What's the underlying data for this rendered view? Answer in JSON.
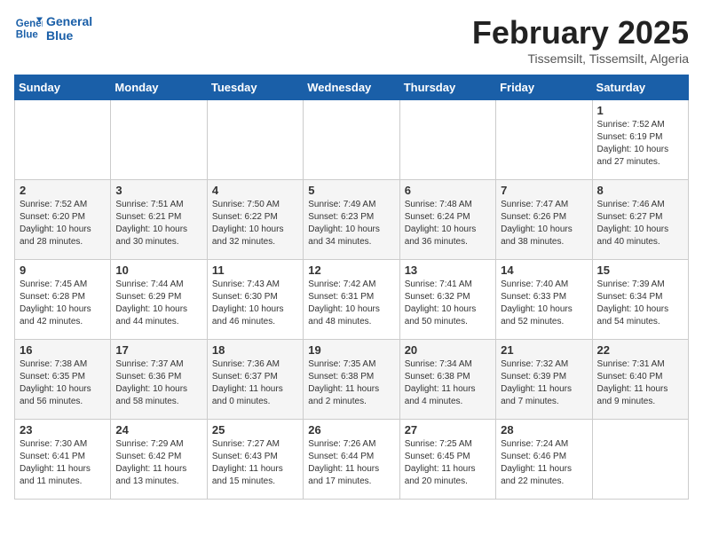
{
  "logo": {
    "line1": "General",
    "line2": "Blue"
  },
  "title": "February 2025",
  "subtitle": "Tissemsilt, Tissemsilt, Algeria",
  "weekdays": [
    "Sunday",
    "Monday",
    "Tuesday",
    "Wednesday",
    "Thursday",
    "Friday",
    "Saturday"
  ],
  "weeks": [
    [
      {
        "day": "",
        "info": ""
      },
      {
        "day": "",
        "info": ""
      },
      {
        "day": "",
        "info": ""
      },
      {
        "day": "",
        "info": ""
      },
      {
        "day": "",
        "info": ""
      },
      {
        "day": "",
        "info": ""
      },
      {
        "day": "1",
        "info": "Sunrise: 7:52 AM\nSunset: 6:19 PM\nDaylight: 10 hours\nand 27 minutes."
      }
    ],
    [
      {
        "day": "2",
        "info": "Sunrise: 7:52 AM\nSunset: 6:20 PM\nDaylight: 10 hours\nand 28 minutes."
      },
      {
        "day": "3",
        "info": "Sunrise: 7:51 AM\nSunset: 6:21 PM\nDaylight: 10 hours\nand 30 minutes."
      },
      {
        "day": "4",
        "info": "Sunrise: 7:50 AM\nSunset: 6:22 PM\nDaylight: 10 hours\nand 32 minutes."
      },
      {
        "day": "5",
        "info": "Sunrise: 7:49 AM\nSunset: 6:23 PM\nDaylight: 10 hours\nand 34 minutes."
      },
      {
        "day": "6",
        "info": "Sunrise: 7:48 AM\nSunset: 6:24 PM\nDaylight: 10 hours\nand 36 minutes."
      },
      {
        "day": "7",
        "info": "Sunrise: 7:47 AM\nSunset: 6:26 PM\nDaylight: 10 hours\nand 38 minutes."
      },
      {
        "day": "8",
        "info": "Sunrise: 7:46 AM\nSunset: 6:27 PM\nDaylight: 10 hours\nand 40 minutes."
      }
    ],
    [
      {
        "day": "9",
        "info": "Sunrise: 7:45 AM\nSunset: 6:28 PM\nDaylight: 10 hours\nand 42 minutes."
      },
      {
        "day": "10",
        "info": "Sunrise: 7:44 AM\nSunset: 6:29 PM\nDaylight: 10 hours\nand 44 minutes."
      },
      {
        "day": "11",
        "info": "Sunrise: 7:43 AM\nSunset: 6:30 PM\nDaylight: 10 hours\nand 46 minutes."
      },
      {
        "day": "12",
        "info": "Sunrise: 7:42 AM\nSunset: 6:31 PM\nDaylight: 10 hours\nand 48 minutes."
      },
      {
        "day": "13",
        "info": "Sunrise: 7:41 AM\nSunset: 6:32 PM\nDaylight: 10 hours\nand 50 minutes."
      },
      {
        "day": "14",
        "info": "Sunrise: 7:40 AM\nSunset: 6:33 PM\nDaylight: 10 hours\nand 52 minutes."
      },
      {
        "day": "15",
        "info": "Sunrise: 7:39 AM\nSunset: 6:34 PM\nDaylight: 10 hours\nand 54 minutes."
      }
    ],
    [
      {
        "day": "16",
        "info": "Sunrise: 7:38 AM\nSunset: 6:35 PM\nDaylight: 10 hours\nand 56 minutes."
      },
      {
        "day": "17",
        "info": "Sunrise: 7:37 AM\nSunset: 6:36 PM\nDaylight: 10 hours\nand 58 minutes."
      },
      {
        "day": "18",
        "info": "Sunrise: 7:36 AM\nSunset: 6:37 PM\nDaylight: 11 hours\nand 0 minutes."
      },
      {
        "day": "19",
        "info": "Sunrise: 7:35 AM\nSunset: 6:38 PM\nDaylight: 11 hours\nand 2 minutes."
      },
      {
        "day": "20",
        "info": "Sunrise: 7:34 AM\nSunset: 6:38 PM\nDaylight: 11 hours\nand 4 minutes."
      },
      {
        "day": "21",
        "info": "Sunrise: 7:32 AM\nSunset: 6:39 PM\nDaylight: 11 hours\nand 7 minutes."
      },
      {
        "day": "22",
        "info": "Sunrise: 7:31 AM\nSunset: 6:40 PM\nDaylight: 11 hours\nand 9 minutes."
      }
    ],
    [
      {
        "day": "23",
        "info": "Sunrise: 7:30 AM\nSunset: 6:41 PM\nDaylight: 11 hours\nand 11 minutes."
      },
      {
        "day": "24",
        "info": "Sunrise: 7:29 AM\nSunset: 6:42 PM\nDaylight: 11 hours\nand 13 minutes."
      },
      {
        "day": "25",
        "info": "Sunrise: 7:27 AM\nSunset: 6:43 PM\nDaylight: 11 hours\nand 15 minutes."
      },
      {
        "day": "26",
        "info": "Sunrise: 7:26 AM\nSunset: 6:44 PM\nDaylight: 11 hours\nand 17 minutes."
      },
      {
        "day": "27",
        "info": "Sunrise: 7:25 AM\nSunset: 6:45 PM\nDaylight: 11 hours\nand 20 minutes."
      },
      {
        "day": "28",
        "info": "Sunrise: 7:24 AM\nSunset: 6:46 PM\nDaylight: 11 hours\nand 22 minutes."
      },
      {
        "day": "",
        "info": ""
      }
    ]
  ]
}
